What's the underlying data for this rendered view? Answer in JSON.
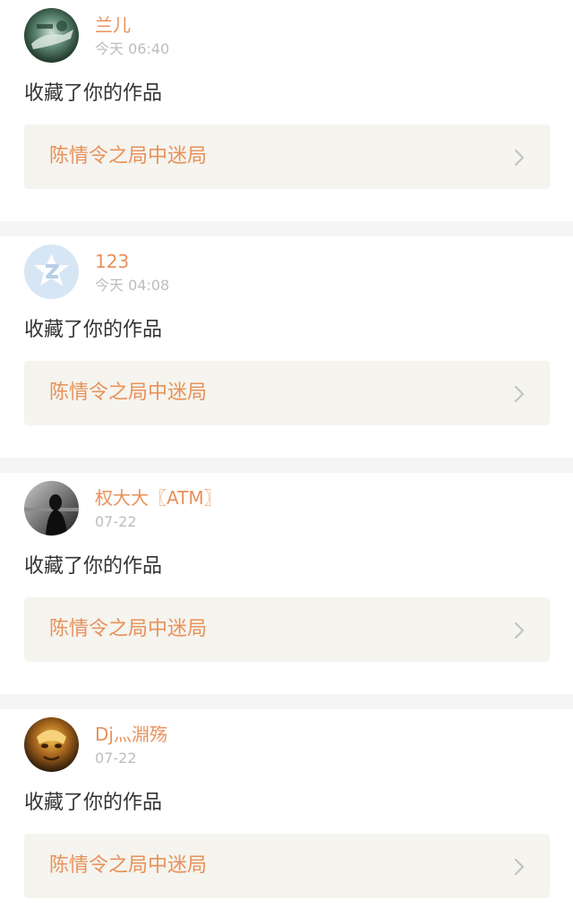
{
  "notifications": [
    {
      "username": "兰儿",
      "time": "今天 06:40",
      "action": "收藏了你的作品",
      "work_title": "陈情令之局中迷局",
      "avatar": "dark-green-photo-avatar"
    },
    {
      "username": "123",
      "time": "今天 04:08",
      "action": "收藏了你的作品",
      "work_title": "陈情令之局中迷局",
      "avatar": "light-blue-default-avatar"
    },
    {
      "username": "权大大〖ATM〗",
      "time": "07-22",
      "action": "收藏了你的作品",
      "work_title": "陈情令之局中迷局",
      "avatar": "grayscale-portrait-avatar"
    },
    {
      "username": "Dj灬淵殇",
      "time": "07-22",
      "action": "收藏了你的作品",
      "work_title": "陈情令之局中迷局",
      "avatar": "golden-mask-avatar"
    }
  ],
  "colors": {
    "accent": "#e8915a",
    "text": "#333333",
    "muted": "#bdbdbd",
    "link_bg": "#f5f4ee",
    "separator": "#f5f5f5"
  }
}
